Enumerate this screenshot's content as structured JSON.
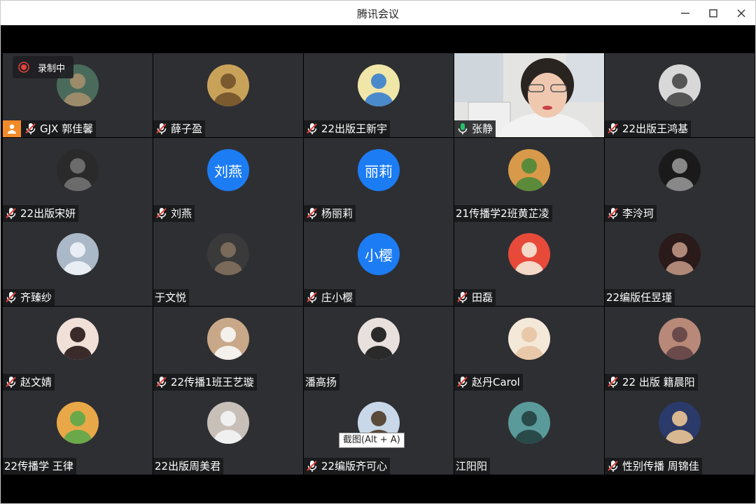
{
  "window": {
    "title": "腾讯会议"
  },
  "recording": {
    "label": "录制中"
  },
  "tooltip": {
    "label": "截图(Alt + A)"
  },
  "colors": {
    "tile_bg": "#2e2f33",
    "accent_blue": "#1c7cf4",
    "speaking_green": "#22c36a",
    "host_orange": "#f28a2a",
    "mute_red": "#e0443c"
  },
  "participants": [
    {
      "name": "GJX 郭佳馨",
      "muted": true,
      "host": true,
      "avatar": "photo"
    },
    {
      "name": "薛子盈",
      "muted": true,
      "avatar": "photo"
    },
    {
      "name": "22出版王新宇",
      "muted": true,
      "avatar": "photo"
    },
    {
      "name": "张静",
      "muted": false,
      "speaking": true,
      "avatar": "video"
    },
    {
      "name": "22出版王鸿基",
      "muted": true,
      "avatar": "photo"
    },
    {
      "name": "22出版宋妍",
      "muted": true,
      "avatar": "photo"
    },
    {
      "name": "刘燕",
      "muted": true,
      "avatar": "text",
      "avatar_text": "刘燕"
    },
    {
      "name": "杨丽莉",
      "muted": true,
      "avatar": "text",
      "avatar_text": "丽莉"
    },
    {
      "name": "21传播学2班黄芷凌",
      "muted": null,
      "avatar": "photo"
    },
    {
      "name": "李泠珂",
      "muted": true,
      "avatar": "photo"
    },
    {
      "name": "齐臻纱",
      "muted": true,
      "avatar": "photo"
    },
    {
      "name": "于文悦",
      "muted": null,
      "avatar": "photo"
    },
    {
      "name": "庄小樱",
      "muted": true,
      "avatar": "text",
      "avatar_text": "小樱"
    },
    {
      "name": "田磊",
      "muted": true,
      "avatar": "photo"
    },
    {
      "name": "22编版任昱瑾",
      "muted": null,
      "avatar": "photo"
    },
    {
      "name": "赵文婧",
      "muted": true,
      "avatar": "photo"
    },
    {
      "name": "22传播1班王艺璇",
      "muted": true,
      "avatar": "photo"
    },
    {
      "name": "潘高扬",
      "muted": null,
      "avatar": "photo"
    },
    {
      "name": "赵丹Carol",
      "muted": true,
      "avatar": "photo"
    },
    {
      "name": "22 出版 籍晨阳",
      "muted": true,
      "avatar": "photo"
    },
    {
      "name": "22传播学 王律",
      "muted": null,
      "avatar": "photo"
    },
    {
      "name": "22出版周美君",
      "muted": null,
      "avatar": "photo"
    },
    {
      "name": "22编版齐可心",
      "muted": true,
      "avatar": "photo"
    },
    {
      "name": "江阳阳",
      "muted": null,
      "avatar": "photo"
    },
    {
      "name": "性别传播 周锦佳",
      "muted": true,
      "avatar": "photo"
    }
  ]
}
